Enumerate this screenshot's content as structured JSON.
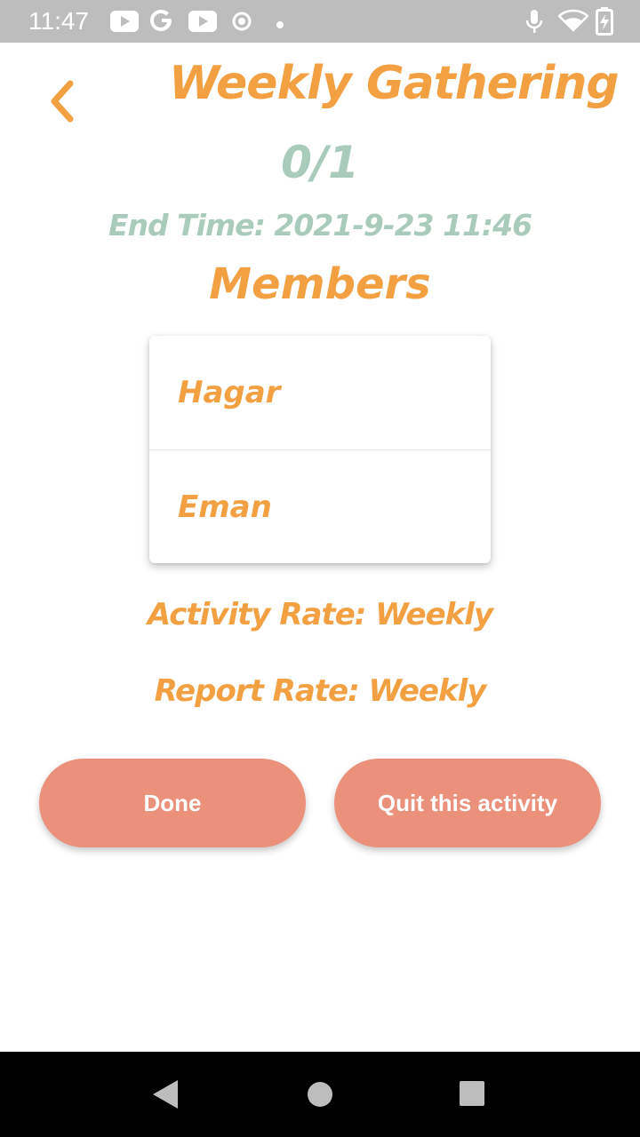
{
  "status_bar": {
    "time": "11:47",
    "icons": [
      "youtube-icon",
      "google-icon",
      "youtube-icon",
      "record-icon",
      "dot-icon",
      "mic-icon",
      "wifi-icon",
      "battery-icon"
    ]
  },
  "header": {
    "back_icon": "chevron-left-icon",
    "title": "Weekly Gathering",
    "count": "0/1",
    "end_time": "End Time: 2021-9-23 11:46"
  },
  "members": {
    "heading": "Members",
    "items": [
      {
        "name": "Hagar"
      },
      {
        "name": "Eman"
      }
    ]
  },
  "rates": {
    "activity": "Activity Rate: Weekly",
    "report": "Report Rate: Weekly"
  },
  "actions": {
    "done_label": "Done",
    "quit_label": "Quit this activity"
  },
  "colors": {
    "accent_orange": "#f3a043",
    "muted_green": "#a9cbbb",
    "button_salmon": "#ea907b",
    "status_bar_gray": "#bdbdbd"
  },
  "nav_bar": {
    "icons": [
      "back-triangle-icon",
      "home-circle-icon",
      "recents-square-icon"
    ]
  }
}
